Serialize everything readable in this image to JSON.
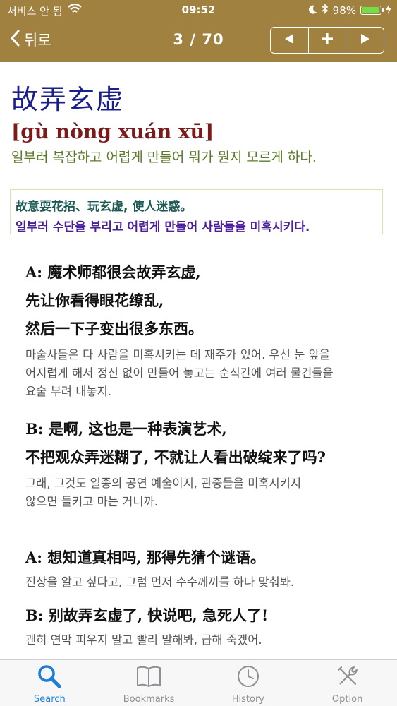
{
  "status_bar": {
    "carrier": "서비스 안 됨",
    "time": "09:52",
    "battery": "98%",
    "battery_level": 0.98
  },
  "nav": {
    "back_label": "뒤로",
    "counter": "3 / 70"
  },
  "entry": {
    "headword": "故弄玄虚",
    "pinyin": "[gù nòng xuán xū]",
    "meaning_ko": "일부러 복잡하고 어렵게 만들어 뭐가 뭔지 모르게 하다.",
    "definition_zh": "故意耍花招、玩玄虚, 使人迷惑。",
    "definition_ko": "일부러 수단을 부리고 어렵게 만들어 사람들을 미혹시키다."
  },
  "dialogs": [
    {
      "lines": [
        "A: 魔术师都很会故弄玄虚,",
        "先让你看得眼花缭乱,",
        "然后一下子变出很多东西。"
      ],
      "ko": [
        "마술사들은 다 사람을 미혹시키는 데 재주가 있어. 우선 눈 앞을",
        "어지럽게 해서 정신 없이 만들어 놓고는 순식간에 여러 물건들을",
        "요술 부려 내놓지."
      ]
    },
    {
      "lines": [
        "B: 是啊, 这也是一种表演艺术,",
        "不把观众弄迷糊了, 不就让人看出破绽来了吗?"
      ],
      "ko": [
        "그래, 그것도 일종의 공연 예술이지, 관중들을 미혹시키지",
        "않으면 들키고 마는 거니까."
      ]
    },
    {
      "lines": [
        "A: 想知道真相吗, 那得先猜个谜语。"
      ],
      "ko": [
        "진상을 알고 싶다고, 그럼 먼저 수수께끼를 하나 맞춰봐."
      ]
    },
    {
      "lines": [
        "B: 别故弄玄虚了, 快说吧, 急死人了!"
      ],
      "ko": [
        "괜히 연막 피우지 말고 빨리 말해봐, 급해 죽겠어."
      ]
    }
  ],
  "tabs": [
    {
      "label": "Search",
      "icon": "search-icon",
      "active": true
    },
    {
      "label": "Bookmarks",
      "icon": "book-icon",
      "active": false
    },
    {
      "label": "History",
      "icon": "clock-icon",
      "active": false
    },
    {
      "label": "Option",
      "icon": "tools-icon",
      "active": false
    }
  ],
  "colors": {
    "nav_bg": "#a0813f",
    "headword": "#1a1f8c",
    "pinyin": "#7a1a1a",
    "meaning": "#5b7a2a",
    "tab_active": "#1f7fd6"
  }
}
